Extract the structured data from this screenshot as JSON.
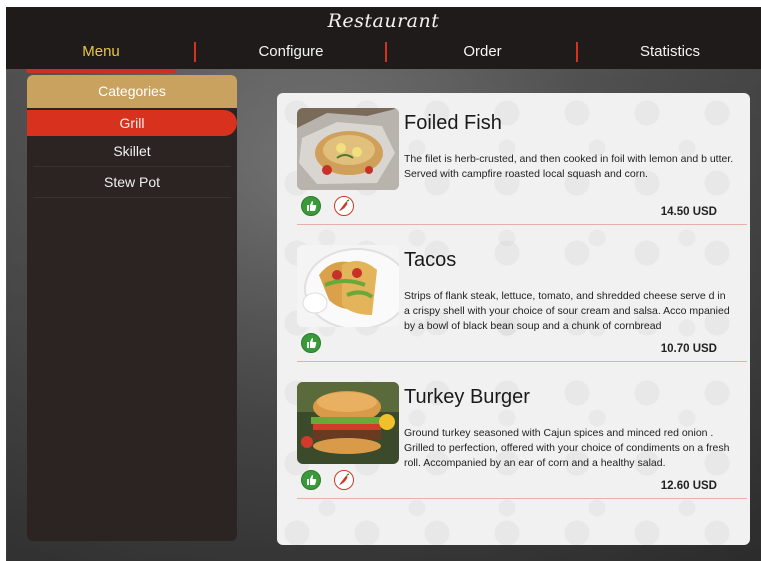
{
  "app": {
    "title": "Restaurant"
  },
  "nav": {
    "tabs": [
      {
        "label": "Menu"
      },
      {
        "label": "Configure"
      },
      {
        "label": "Order"
      },
      {
        "label": "Statistics"
      }
    ],
    "active_tab": "Menu"
  },
  "sidebar": {
    "header": "Categories",
    "items": [
      {
        "label": "Grill"
      },
      {
        "label": "Skillet"
      },
      {
        "label": "Stew Pot"
      }
    ],
    "active_item": "Grill"
  },
  "menu_items": [
    {
      "name": "Foiled Fish",
      "description": "The filet is herb-crusted, and then cooked in foil with lemon and b utter. Served with campfire roasted local squash and corn.",
      "price": "14.50 USD",
      "icons": [
        "thumbs-up-icon",
        "chili-pepper-icon"
      ]
    },
    {
      "name": "Tacos",
      "description": "Strips of flank steak, lettuce, tomato, and shredded cheese serve d in a crispy shell with your choice of sour cream and salsa. Acco mpanied by a bowl of black bean soup and a chunk of cornbread",
      "price": "10.70 USD",
      "icons": [
        "thumbs-up-icon"
      ]
    },
    {
      "name": "Turkey Burger",
      "description": "Ground turkey seasoned with Cajun spices and minced red onion . Grilled to perfection, offered with your choice of condiments on a fresh roll. Accompanied by an ear of corn and a healthy salad.",
      "price": "12.60 USD",
      "icons": [
        "thumbs-up-icon",
        "chili-pepper-icon"
      ]
    }
  ],
  "colors": {
    "accent_red": "#d8321f",
    "gold": "#c9a25f",
    "active_tab_text": "#e6c84a",
    "dark": "#1f1b1a"
  }
}
